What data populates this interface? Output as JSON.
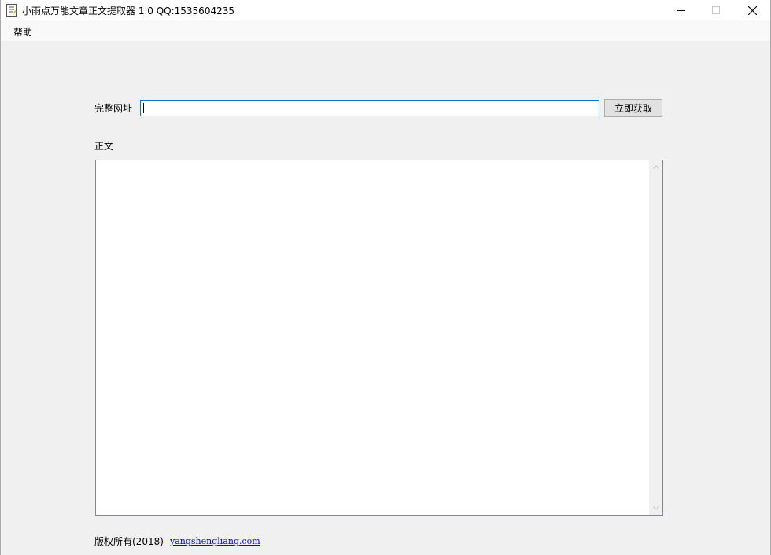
{
  "window": {
    "title": "小雨点万能文章正文提取器 1.0   QQ:1535604235",
    "icon": "notepad-icon",
    "controls": [
      "minimize-icon",
      "maximize-icon",
      "close-icon"
    ]
  },
  "menu": {
    "items": [
      {
        "label": "帮助"
      }
    ]
  },
  "form": {
    "url_label": "完整网址",
    "url_value": "",
    "fetch_button": "立即获取",
    "body_label": "正文",
    "body_value": ""
  },
  "footer": {
    "copyright": "版权所有(2018)",
    "link": "yangshengliang.com"
  },
  "colors": {
    "window_bg": "#f0f0f0",
    "input_focus_border": "#0078d7",
    "link": "#0000ff"
  }
}
